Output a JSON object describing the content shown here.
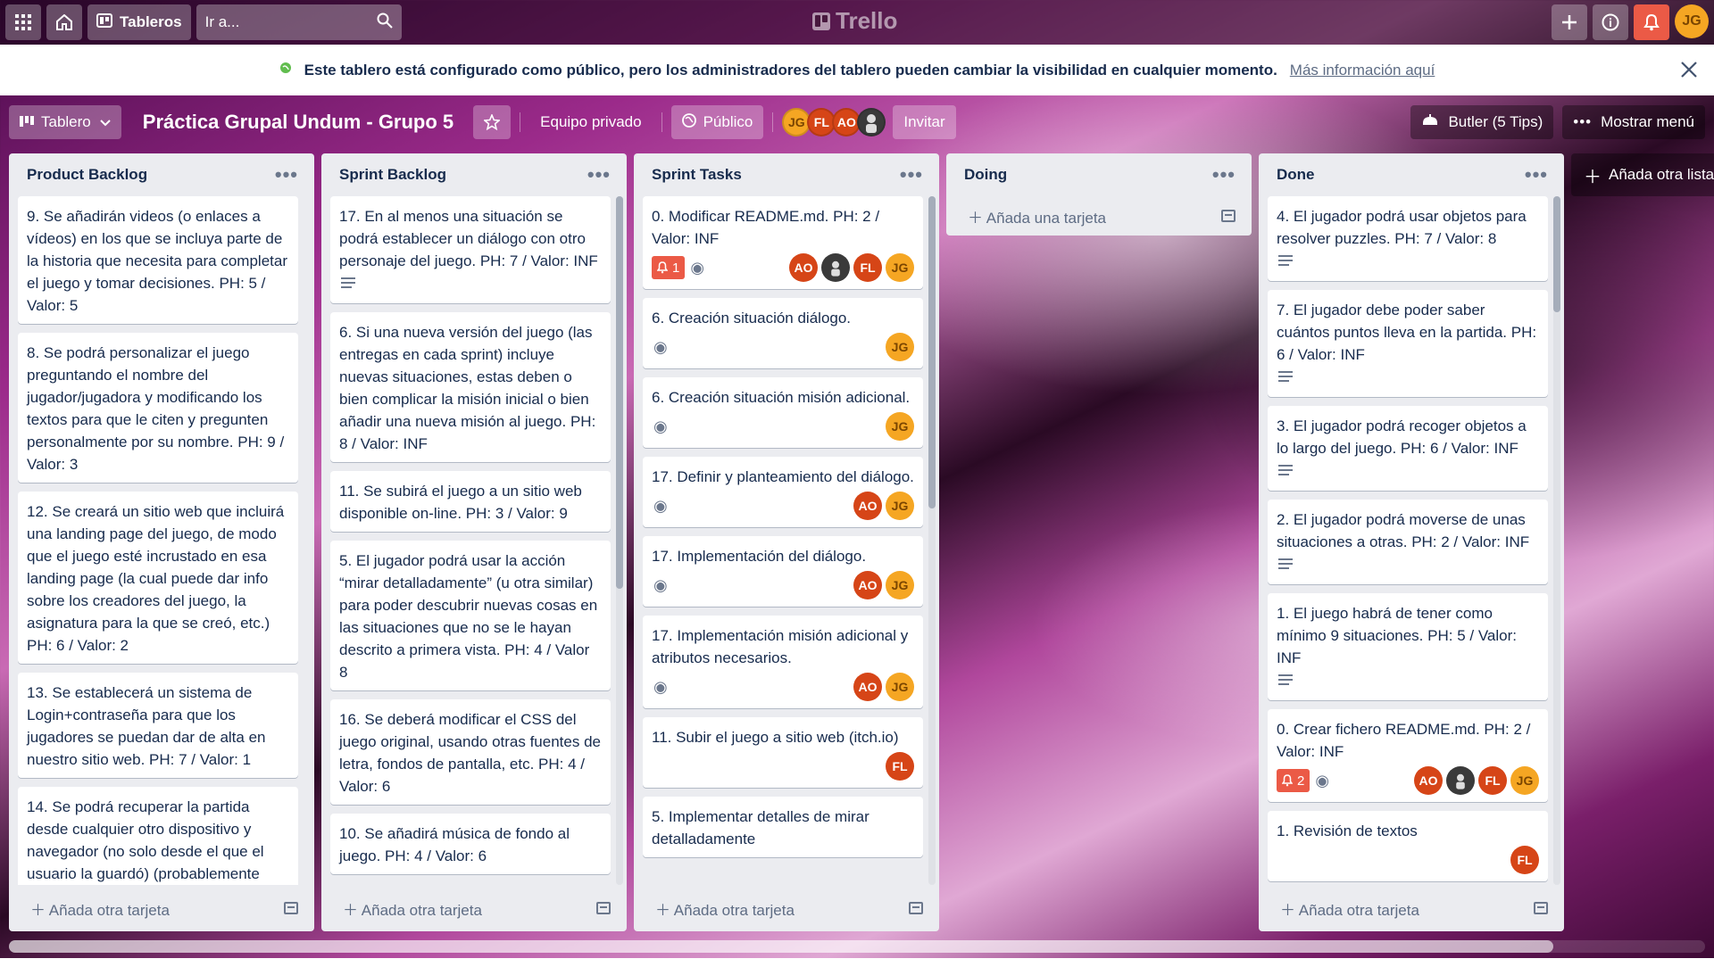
{
  "header": {
    "boards_label": "Tableros",
    "search_placeholder": "Ir a...",
    "logo_text": "Trello",
    "user_initials": "JG"
  },
  "banner": {
    "message": "Este tablero está configurado como público, pero los administradores del tablero pueden cambiar la visibilidad en cualquier momento.",
    "link": "Más información aquí"
  },
  "board": {
    "view_label": "Tablero",
    "title": "Práctica Grupal Undum - Grupo 5",
    "team_label": "Equipo privado",
    "visibility_label": "Público",
    "members": [
      "JG",
      "FL",
      "AO"
    ],
    "invite_label": "Invitar",
    "butler_label": "Butler (5 Tips)",
    "menu_label": "Mostrar menú"
  },
  "add_card_label": "Añada otra tarjeta",
  "add_card_first_label": "Añada una tarjeta",
  "add_list_label": "Añada otra lista",
  "lists": [
    {
      "title": "Product Backlog",
      "cards": [
        {
          "text": "9. Se añadirán videos (o enlaces a vídeos) en los que se incluya parte de la historia que necesita para completar el juego y tomar decisiones. PH: 5 / Valor: 5"
        },
        {
          "text": "8. Se podrá personalizar el juego preguntando el nombre del jugador/jugadora y modificando los textos para que le citen y pregunten personalmente por su nombre. PH: 9 / Valor: 3"
        },
        {
          "text": "12. Se creará un sitio web que incluirá una landing page del juego, de modo que el juego esté incrustado en esa landing page (la cual puede dar info sobre los creadores del juego, la asignatura para la que se creó, etc.) PH: 6 / Valor: 2"
        },
        {
          "text": "13. Se establecerá un sistema de Login+contraseña para que los jugadores se puedan dar de alta en nuestro sitio web. PH: 7 / Valor: 1"
        },
        {
          "text": "14. Se podrá recuperar la partida desde cualquier otro dispositivo y navegador (no solo desde el que el usuario la guardó) (probablemente"
        }
      ]
    },
    {
      "title": "Sprint Backlog",
      "cards": [
        {
          "text": "17. En al menos una situación se podrá establecer un diálogo con otro personaje del juego. PH: 7 / Valor: INF"
        },
        {
          "text": "6. Si una nueva versión del juego (las entregas en cada sprint) incluye nuevas situaciones, estas deben o bien complicar la misión inicial o bien añadir una nueva misión al juego. PH: 8 / Valor: INF"
        },
        {
          "text": "11. Se subirá el juego a un sitio web disponible on-line. PH: 3 / Valor: 9"
        },
        {
          "text": "5. El jugador podrá usar la acción “mirar detalladamente” (u otra similar) para poder descubrir nuevas cosas en las situaciones que no se le hayan descrito a primera vista. PH: 4 / Valor 8"
        },
        {
          "text": "16. Se deberá modificar el CSS del juego original, usando otras fuentes de letra, fondos de pantalla, etc. PH: 4 / Valor: 6"
        },
        {
          "text": "10. Se añadirá música de fondo al juego. PH: 4 / Valor: 6"
        }
      ]
    },
    {
      "title": "Sprint Tasks",
      "cards": [
        {
          "text": "0. Modificar README.md. PH: 2 / Valor: INF",
          "notif": "1"
        },
        {
          "text": "6. Creación situación diálogo."
        },
        {
          "text": "6. Creación situación misión adicional."
        },
        {
          "text": "17. Definir y planteamiento del diálogo."
        },
        {
          "text": "17. Implementación del diálogo."
        },
        {
          "text": "17. Implementación misión adicional y atributos necesarios."
        },
        {
          "text": "11. Subir el juego a sitio web (itch.io)"
        },
        {
          "text": "5. Implementar detalles de mirar detalladamente"
        }
      ]
    },
    {
      "title": "Doing",
      "cards": []
    },
    {
      "title": "Done",
      "cards": [
        {
          "text": "4. El jugador podrá usar objetos para resolver puzzles. PH: 7 / Valor: 8"
        },
        {
          "text": "7. El jugador debe poder saber cuántos puntos lleva en la partida. PH: 6 / Valor: INF"
        },
        {
          "text": "3. El jugador podrá recoger objetos a lo largo del juego. PH: 6 / Valor: INF"
        },
        {
          "text": "2. El jugador podrá moverse de unas situaciones a otras. PH: 2 / Valor: INF"
        },
        {
          "text": "1. El juego habrá de tener como mínimo 9 situaciones. PH: 5 / Valor: INF"
        },
        {
          "text": "0. Crear fichero README.md. PH: 2 / Valor: INF",
          "notif": "2"
        },
        {
          "text": "1. Revisión de textos"
        }
      ]
    }
  ],
  "colors": {
    "accent": "#eb5a46",
    "jg": "#f5a623",
    "ao_fl": "#d64517"
  }
}
